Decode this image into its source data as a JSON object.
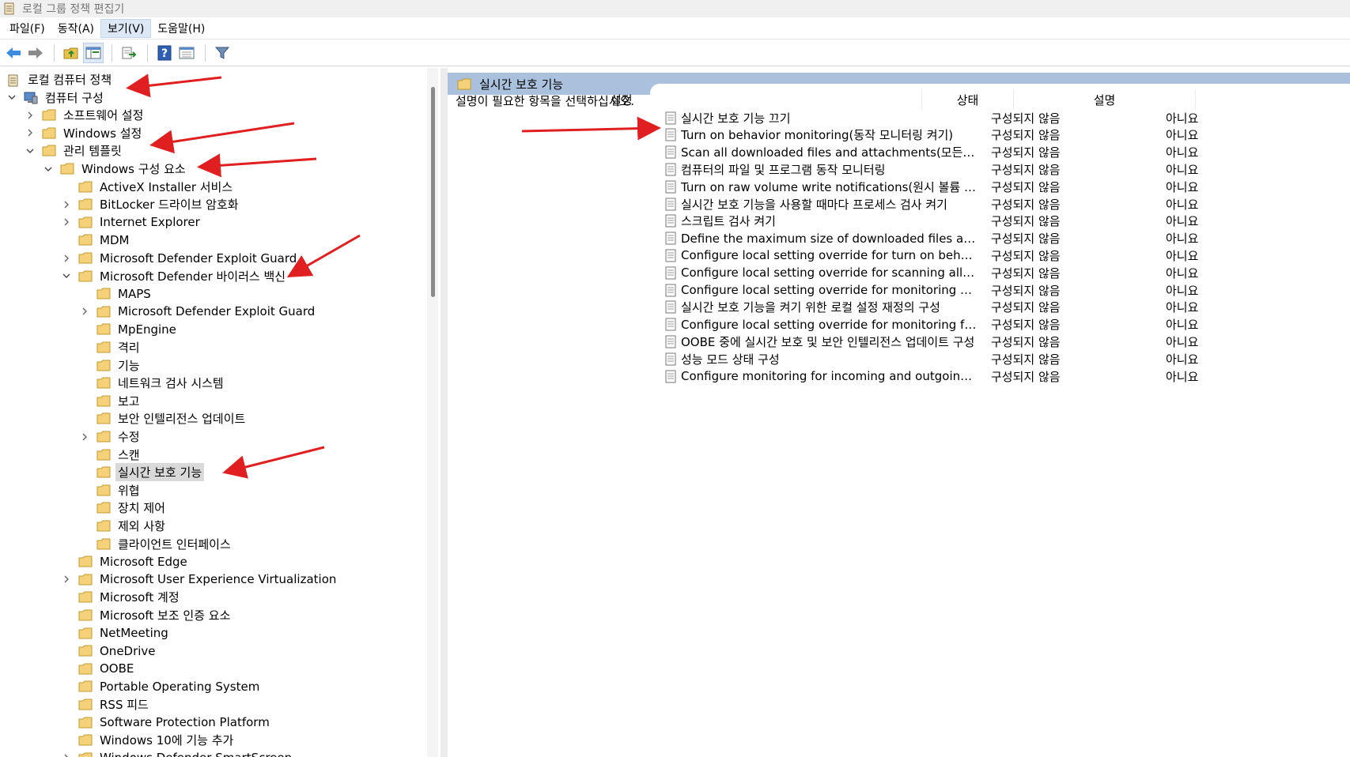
{
  "window": {
    "title": "로컬 그룹 정책 편집기"
  },
  "menu": [
    "파일(F)",
    "동작(A)",
    "보기(V)",
    "도움말(H)"
  ],
  "toolbar": [
    "back-icon",
    "forward-icon",
    "up-folder-icon",
    "show-hide-tree-icon",
    "export-list-icon",
    "help-icon",
    "properties-icon",
    "filter-icon"
  ],
  "tree": [
    {
      "label": "로컬 컴퓨터 정책",
      "depth": 0,
      "icon": "policy"
    },
    {
      "label": "컴퓨터 구성",
      "depth": 0,
      "icon": "computer",
      "state": "expanded"
    },
    {
      "label": "소프트웨어 설정",
      "depth": 1,
      "state": "collapsed"
    },
    {
      "label": "Windows 설정",
      "depth": 1,
      "state": "collapsed"
    },
    {
      "label": "관리 템플릿",
      "depth": 1,
      "state": "expanded"
    },
    {
      "label": "Windows 구성 요소",
      "depth": 2,
      "state": "expanded"
    },
    {
      "label": "ActiveX Installer 서비스",
      "depth": 3
    },
    {
      "label": "BitLocker 드라이브 암호화",
      "depth": 3,
      "state": "collapsed"
    },
    {
      "label": "Internet Explorer",
      "depth": 3,
      "state": "collapsed"
    },
    {
      "label": "MDM",
      "depth": 3
    },
    {
      "label": "Microsoft Defender Exploit Guard",
      "depth": 3,
      "state": "collapsed"
    },
    {
      "label": "Microsoft Defender 바이러스 백신",
      "depth": 3,
      "state": "expanded"
    },
    {
      "label": "MAPS",
      "depth": 4
    },
    {
      "label": "Microsoft Defender Exploit Guard",
      "depth": 4,
      "state": "collapsed"
    },
    {
      "label": "MpEngine",
      "depth": 4
    },
    {
      "label": "격리",
      "depth": 4
    },
    {
      "label": "기능",
      "depth": 4
    },
    {
      "label": "네트워크 검사 시스템",
      "depth": 4
    },
    {
      "label": "보고",
      "depth": 4
    },
    {
      "label": "보안 인텔리전스 업데이트",
      "depth": 4
    },
    {
      "label": "수정",
      "depth": 4,
      "state": "collapsed"
    },
    {
      "label": "스캔",
      "depth": 4
    },
    {
      "label": "실시간 보호 기능",
      "depth": 4,
      "selected": true
    },
    {
      "label": "위협",
      "depth": 4
    },
    {
      "label": "장치 제어",
      "depth": 4
    },
    {
      "label": "제외 사항",
      "depth": 4
    },
    {
      "label": "클라이언트 인터페이스",
      "depth": 4
    },
    {
      "label": "Microsoft Edge",
      "depth": 3
    },
    {
      "label": "Microsoft User Experience Virtualization",
      "depth": 3,
      "state": "collapsed"
    },
    {
      "label": "Microsoft 계정",
      "depth": 3
    },
    {
      "label": "Microsoft 보조 인증 요소",
      "depth": 3
    },
    {
      "label": "NetMeeting",
      "depth": 3
    },
    {
      "label": "OneDrive",
      "depth": 3
    },
    {
      "label": "OOBE",
      "depth": 3
    },
    {
      "label": "Portable Operating System",
      "depth": 3
    },
    {
      "label": "RSS 피드",
      "depth": 3
    },
    {
      "label": "Software Protection Platform",
      "depth": 3
    },
    {
      "label": "Windows 10에 기능 추가",
      "depth": 3
    },
    {
      "label": "Windows Defender SmartScreen",
      "depth": 3,
      "state": "collapsed"
    }
  ],
  "right": {
    "header": "실시간 보호 기능",
    "description": "설명이 필요한 항목을 선택하십시오.",
    "columns": [
      "설정",
      "상태",
      "설명"
    ],
    "rows": [
      {
        "name": "실시간 보호 기능 끄기",
        "state": "구성되지 않음",
        "comment": "아니요"
      },
      {
        "name": "Turn on behavior monitoring(동작 모니터링 켜기)",
        "state": "구성되지 않음",
        "comment": "아니요"
      },
      {
        "name": "Scan all downloaded files and attachments(모든 다운로드한...",
        "state": "구성되지 않음",
        "comment": "아니요"
      },
      {
        "name": "컴퓨터의 파일 및 프로그램 동작 모니터링",
        "state": "구성되지 않음",
        "comment": "아니요"
      },
      {
        "name": "Turn on raw volume write notifications(원시 볼륨 쓰기 알림...",
        "state": "구성되지 않음",
        "comment": "아니요"
      },
      {
        "name": "실시간 보호 기능을 사용할 때마다 프로세스 검사 켜기",
        "state": "구성되지 않음",
        "comment": "아니요"
      },
      {
        "name": "스크립트 검사 켜기",
        "state": "구성되지 않음",
        "comment": "아니요"
      },
      {
        "name": "Define the maximum size of downloaded files and attachm...",
        "state": "구성되지 않음",
        "comment": "아니요"
      },
      {
        "name": "Configure local setting override for turn on behavior monit...",
        "state": "구성되지 않음",
        "comment": "아니요"
      },
      {
        "name": "Configure local setting override for scanning all downloade...",
        "state": "구성되지 않음",
        "comment": "아니요"
      },
      {
        "name": "Configure local setting override for monitoring file and pro...",
        "state": "구성되지 않음",
        "comment": "아니요"
      },
      {
        "name": "실시간 보호 기능을 켜기 위한 로컬 설정 재정의 구성",
        "state": "구성되지 않음",
        "comment": "아니요"
      },
      {
        "name": "Configure local setting override for monitoring for incomin...",
        "state": "구성되지 않음",
        "comment": "아니요"
      },
      {
        "name": "OOBE 중에 실시간 보호 및 보안 인텔리전스 업데이트 구성",
        "state": "구성되지 않음",
        "comment": "아니요"
      },
      {
        "name": "성능 모드 상태 구성",
        "state": "구성되지 않음",
        "comment": "아니요"
      },
      {
        "name": "Configure monitoring for incoming and outgoing file and ...",
        "state": "구성되지 않음",
        "comment": "아니요"
      }
    ]
  },
  "colors": {
    "header_bg": "#a9c1dc",
    "arrow": "#e02020",
    "folder": "#f5d27a",
    "selected": "#d9d9d9"
  }
}
